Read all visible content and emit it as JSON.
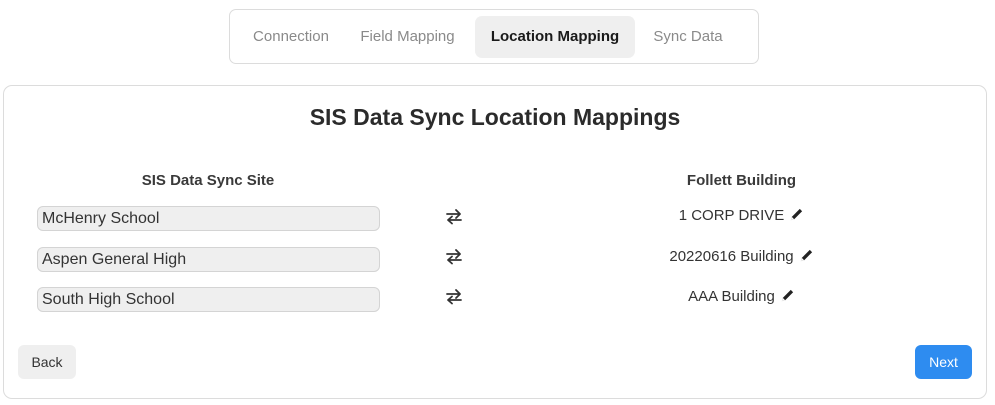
{
  "tabs": [
    {
      "label": "Connection",
      "active": false
    },
    {
      "label": "Field Mapping",
      "active": false
    },
    {
      "label": "Location Mapping",
      "active": true
    },
    {
      "label": "Sync Data",
      "active": false
    }
  ],
  "page_title": "SIS Data Sync Location Mappings",
  "columns": {
    "site": "SIS Data Sync Site",
    "building": "Follett Building"
  },
  "mappings": [
    {
      "site": "McHenry School",
      "building": "1 CORP DRIVE"
    },
    {
      "site": "Aspen General High",
      "building": "20220616 Building"
    },
    {
      "site": "South High School",
      "building": "AAA Building"
    }
  ],
  "icons": {
    "swap": "swap-arrows-icon",
    "edit": "pencil-icon"
  },
  "buttons": {
    "back": "Back",
    "next": "Next"
  },
  "colors": {
    "primary": "#2e8cf0",
    "active_tab_bg": "#efefef"
  }
}
